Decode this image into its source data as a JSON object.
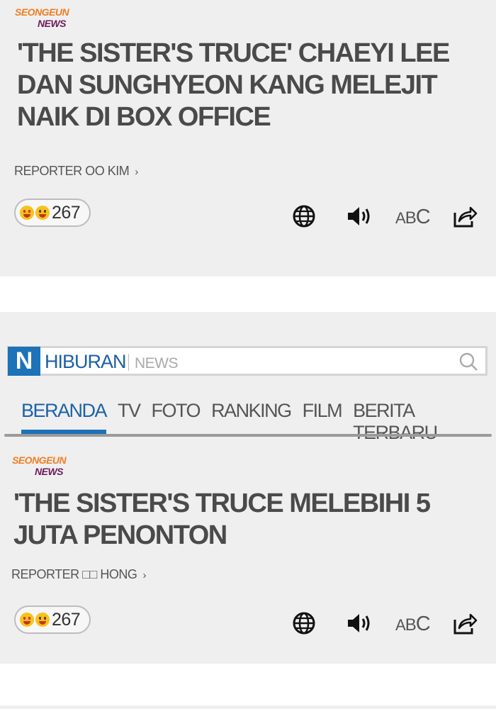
{
  "article1": {
    "logo_line1": "SEONGEUN",
    "logo_line2": "NEWS",
    "headline": "'THE SISTER'S TRUCE' CHAEYI LEE DAN SUNGHYEON KANG MELEJIT NAIK DI BOX OFFICE",
    "reporter": "REPORTER OO KIM",
    "reporter_chevron": "›",
    "reaction_count": "267",
    "abc_label_small": "A",
    "abc_label_mid": "B",
    "abc_label_big": "C"
  },
  "nav": {
    "logo_letter": "N",
    "section": "HIBURAN",
    "subsection": "NEWS",
    "tabs": [
      "BERANDA",
      "TV",
      "FOTO",
      "RANKING",
      "FILM",
      "BERITA TERBARU"
    ],
    "active_tab": "BERANDA"
  },
  "article2": {
    "logo_line1": "SEONGEUN",
    "logo_line2": "NEWS",
    "headline": "'THE SISTER'S TRUCE MELEBIHI 5 JUTA PENONTON",
    "reporter": "REPORTER □□ HONG",
    "reporter_chevron": "›",
    "reaction_count": "267",
    "abc_label_small": "A",
    "abc_label_mid": "B",
    "abc_label_big": "C"
  },
  "icons": {
    "translate": "globe-icon",
    "audio": "speaker-icon",
    "font_size": "font-size-icon",
    "share": "share-icon",
    "search": "search-icon"
  },
  "colors": {
    "logo_orange": "#f07d1f",
    "logo_purple": "#6d1b5a",
    "nav_blue": "#1d72b8",
    "panel_bg": "#efefef"
  }
}
